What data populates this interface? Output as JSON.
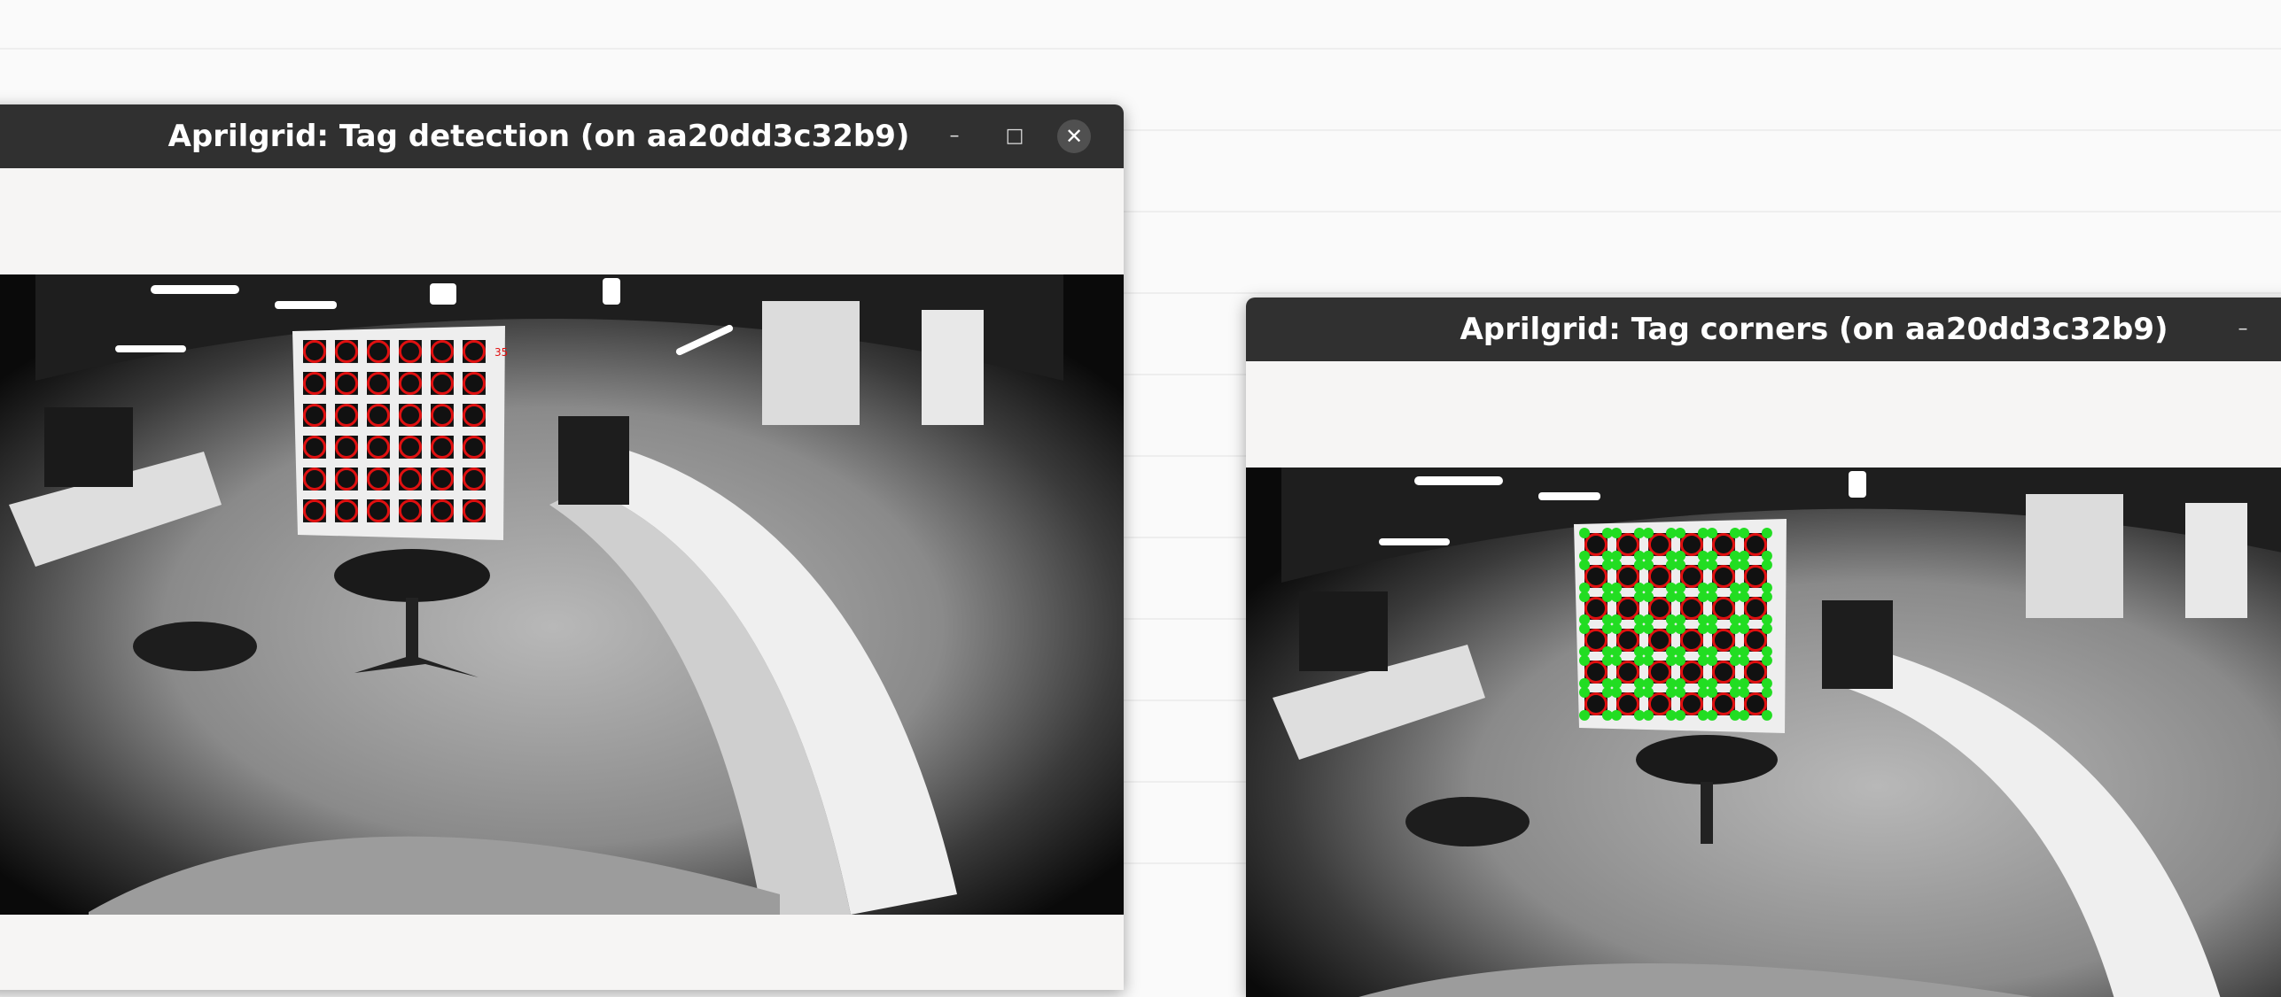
{
  "windows": {
    "detection": {
      "title": "Aprilgrid: Tag detection (on aa20dd3c32b9)",
      "buttons": {
        "minimize": "–",
        "maximize": "□",
        "close": "✕"
      }
    },
    "corners": {
      "title": "Aprilgrid: Tag corners (on aa20dd3c32b9)",
      "buttons": {
        "minimize": "–"
      }
    }
  },
  "colors": {
    "titlebar": "#303030",
    "window_bg": "#f6f5f4",
    "tag_detection": "#e01010",
    "corner_marker": "#22dd22"
  },
  "icons": [
    "minimize-icon",
    "maximize-icon",
    "close-icon"
  ]
}
